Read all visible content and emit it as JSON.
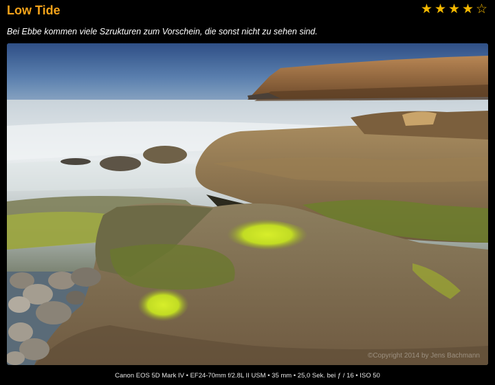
{
  "header": {
    "title": "Low Tide",
    "rating": {
      "value": 4,
      "max": 5,
      "filled_icon": "star-filled-icon",
      "empty_icon": "star-outline-icon",
      "color": "#f5b800"
    },
    "title_color": "#f5a31a"
  },
  "caption": "Bei Ebbe kommen viele Szrukturen zum Vorschein, die sonst nicht zu sehen sind.",
  "photo": {
    "watermark": "©Copyright 2014 by Jens Bachmann"
  },
  "exif": "Canon EOS 5D Mark IV • EF24-70mm f/2.8L II USM • 35 mm • 25,0 Sek. bei ƒ / 16 • ISO 50"
}
